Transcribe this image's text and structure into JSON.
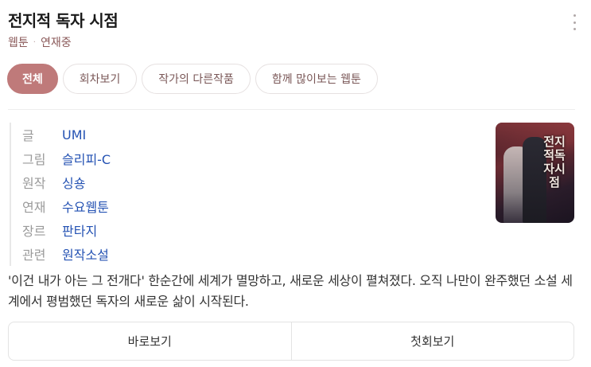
{
  "header": {
    "title": "전지적 독자 시점",
    "category": "웹툰",
    "separator": "·",
    "status": "연재중"
  },
  "tabs": [
    {
      "label": "전체",
      "active": true
    },
    {
      "label": "회차보기",
      "active": false
    },
    {
      "label": "작가의 다른작품",
      "active": false
    },
    {
      "label": "함께 많이보는 웹툰",
      "active": false
    }
  ],
  "info": [
    {
      "key": "글",
      "value": "UMI"
    },
    {
      "key": "그림",
      "value": "슬리피-C"
    },
    {
      "key": "원작",
      "value": "싱숑"
    },
    {
      "key": "연재",
      "value": "수요웹툰"
    },
    {
      "key": "장르",
      "value": "판타지"
    },
    {
      "key": "관련",
      "value": "원작소설"
    }
  ],
  "cover": {
    "title_text": "전지적독자시점"
  },
  "description": "'이건 내가 아는 그 전개다' 한순간에 세계가 멸망하고, 새로운 세상이 펼쳐졌다. 오직 나만이 완주했던 소설 세계에서 평범했던 독자의 새로운 삶이 시작된다.",
  "actions": {
    "view_now": "바로보기",
    "first_episode": "첫회보기"
  },
  "colors": {
    "accent": "#bf7a7a",
    "link": "#2452b3",
    "subtitle": "#8b5a5a"
  }
}
